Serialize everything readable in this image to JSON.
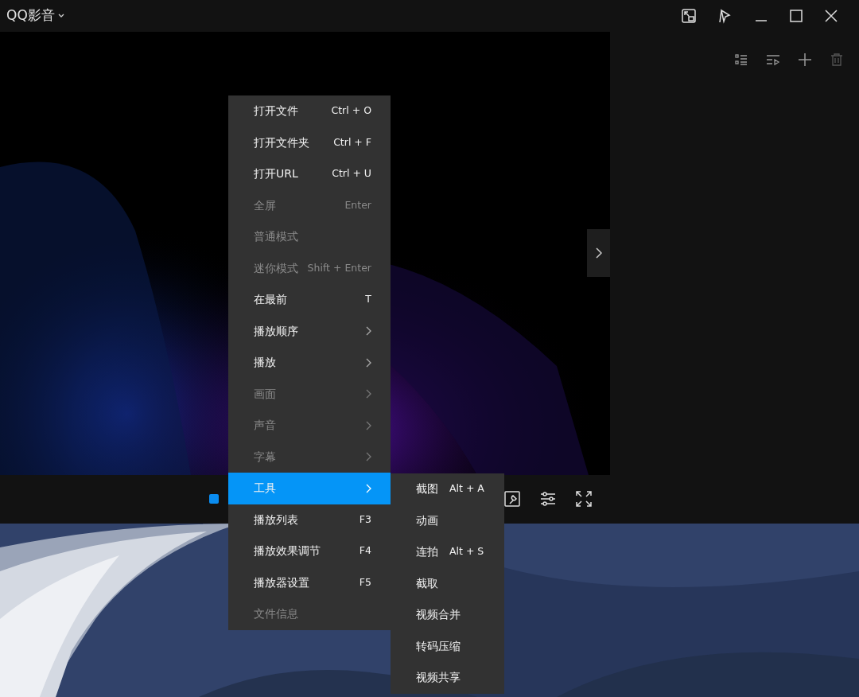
{
  "window": {
    "title": "QQ影音"
  },
  "context_menu": {
    "items": [
      {
        "label": "打开文件",
        "shortcut": "Ctrl + O",
        "submenu": false,
        "disabled": false,
        "selected": false
      },
      {
        "label": "打开文件夹",
        "shortcut": "Ctrl + F",
        "submenu": false,
        "disabled": false,
        "selected": false
      },
      {
        "label": "打开URL",
        "shortcut": "Ctrl + U",
        "submenu": false,
        "disabled": false,
        "selected": false
      },
      {
        "label": "全屏",
        "shortcut": "Enter",
        "submenu": false,
        "disabled": true,
        "selected": false
      },
      {
        "label": "普通模式",
        "submenu": false,
        "disabled": true,
        "selected": false
      },
      {
        "label": "迷你模式",
        "shortcut": "Shift + Enter",
        "submenu": false,
        "disabled": true,
        "selected": false
      },
      {
        "label": "在最前",
        "shortcut": "T",
        "submenu": false,
        "disabled": false,
        "selected": false
      },
      {
        "label": "播放顺序",
        "submenu": true,
        "disabled": false,
        "selected": false
      },
      {
        "label": "播放",
        "submenu": true,
        "disabled": false,
        "selected": false
      },
      {
        "label": "画面",
        "submenu": true,
        "disabled": true,
        "selected": false
      },
      {
        "label": "声音",
        "submenu": true,
        "disabled": true,
        "selected": false
      },
      {
        "label": "字幕",
        "submenu": true,
        "disabled": true,
        "selected": false
      },
      {
        "label": "工具",
        "submenu": true,
        "disabled": false,
        "selected": true
      },
      {
        "label": "播放列表",
        "shortcut": "F3",
        "submenu": false,
        "disabled": false,
        "selected": false
      },
      {
        "label": "播放效果调节",
        "shortcut": "F4",
        "submenu": false,
        "disabled": false,
        "selected": false
      },
      {
        "label": "播放器设置",
        "shortcut": "F5",
        "submenu": false,
        "disabled": false,
        "selected": false
      },
      {
        "label": "文件信息",
        "submenu": false,
        "disabled": true,
        "selected": false
      }
    ]
  },
  "submenu": {
    "items": [
      {
        "label": "截图",
        "shortcut": "Alt + A"
      },
      {
        "label": "动画"
      },
      {
        "label": "连拍",
        "shortcut": "Alt + S"
      },
      {
        "label": "截取"
      },
      {
        "label": "视频合并"
      },
      {
        "label": "转码压缩"
      },
      {
        "label": "视频共享"
      }
    ]
  }
}
